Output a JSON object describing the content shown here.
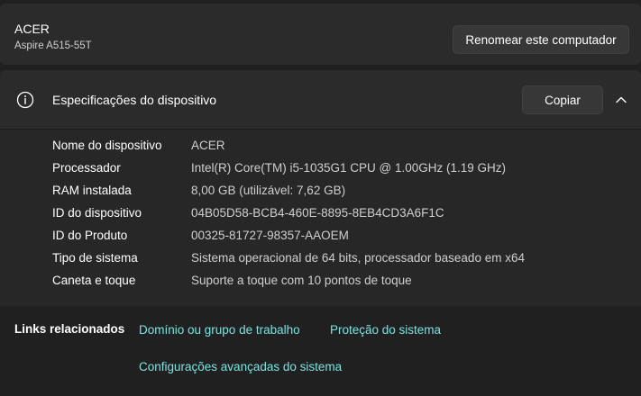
{
  "device": {
    "name": "ACER",
    "model": "Aspire A515-55T",
    "rename_label": "Renomear este computador"
  },
  "specs": {
    "title": "Especificações do dispositivo",
    "copy_label": "Copiar",
    "rows": [
      {
        "label": "Nome do dispositivo",
        "value": "ACER"
      },
      {
        "label": "Processador",
        "value": "Intel(R) Core(TM) i5-1035G1 CPU @ 1.00GHz (1.19 GHz)"
      },
      {
        "label": "RAM instalada",
        "value": "8,00 GB (utilizável: 7,62 GB)"
      },
      {
        "label": "ID do dispositivo",
        "value": "04B05D58-BCB4-460E-8895-8EB4CD3A6F1C"
      },
      {
        "label": "ID do Produto",
        "value": "00325-81727-98357-AAOEM"
      },
      {
        "label": "Tipo de sistema",
        "value": "Sistema operacional de 64 bits, processador baseado em x64"
      },
      {
        "label": "Caneta e toque",
        "value": "Suporte a toque com 10 pontos de toque"
      }
    ]
  },
  "related": {
    "title": "Links relacionados",
    "links": [
      "Domínio ou grupo de trabalho",
      "Proteção do sistema",
      "Configurações avançadas do sistema"
    ]
  },
  "colors": {
    "background": "#202020",
    "card": "#2b2b2b",
    "link": "#76e4e0"
  },
  "icons": {
    "info": "info-icon",
    "collapse": "chevron-up-icon"
  }
}
